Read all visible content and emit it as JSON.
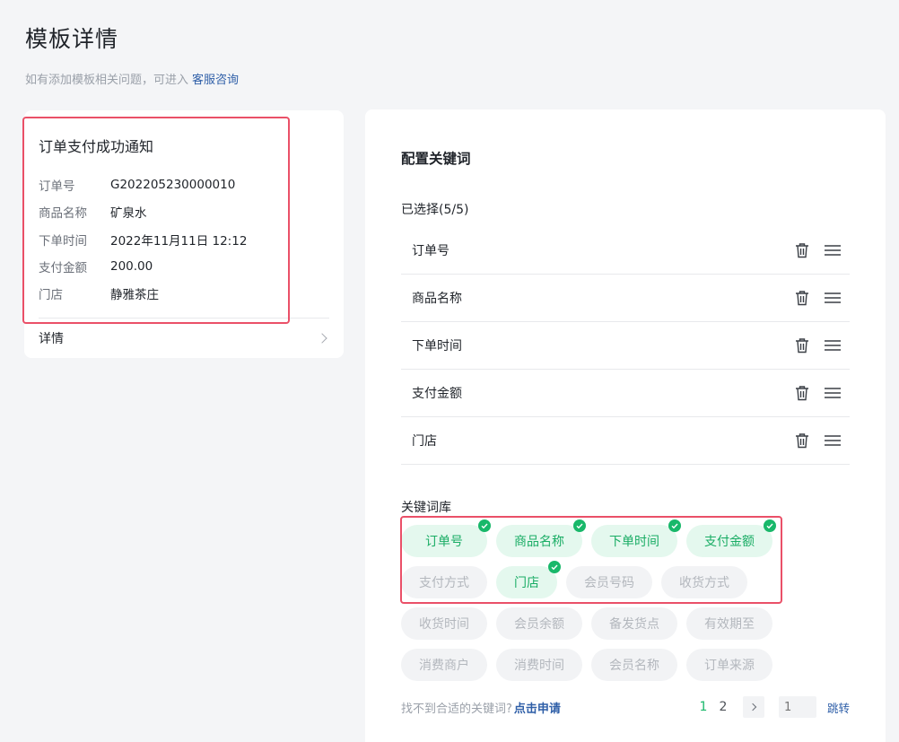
{
  "page": {
    "title": "模板详情",
    "hint": "如有添加模板相关问题，可进入",
    "support_link": "客服咨询"
  },
  "preview": {
    "title": "订单支付成功通知",
    "rows": [
      {
        "key": "订单号",
        "value": "G202205230000010"
      },
      {
        "key": "商品名称",
        "value": "矿泉水"
      },
      {
        "key": "下单时间",
        "value": "2022年11月11日 12:12"
      },
      {
        "key": "支付金额",
        "value": "200.00"
      },
      {
        "key": "门店",
        "value": "静雅茶庄"
      }
    ],
    "detail_label": "详情"
  },
  "config": {
    "title": "配置关键词",
    "selected_label": "已选择(5/5)",
    "selected": [
      "订单号",
      "商品名称",
      "下单时间",
      "支付金额",
      "门店"
    ],
    "library_label": "关键词库",
    "library": [
      [
        {
          "label": "订单号",
          "selected": true
        },
        {
          "label": "商品名称",
          "selected": true
        },
        {
          "label": "下单时间",
          "selected": true
        },
        {
          "label": "支付金额",
          "selected": true
        }
      ],
      [
        {
          "label": "支付方式",
          "selected": false
        },
        {
          "label": "门店",
          "selected": true
        },
        {
          "label": "会员号码",
          "selected": false
        },
        {
          "label": "收货方式",
          "selected": false
        }
      ],
      [
        {
          "label": "收货时间",
          "selected": false
        },
        {
          "label": "会员余额",
          "selected": false
        },
        {
          "label": "备发货点",
          "selected": false
        },
        {
          "label": "有效期至",
          "selected": false
        }
      ],
      [
        {
          "label": "消费商户",
          "selected": false
        },
        {
          "label": "消费时间",
          "selected": false
        },
        {
          "label": "会员名称",
          "selected": false
        },
        {
          "label": "订单来源",
          "selected": false
        }
      ]
    ],
    "footer_hint": "找不到合适的关键词?",
    "apply_link": "点击申请",
    "pager": {
      "pages": [
        "1",
        "2"
      ],
      "current": "1",
      "input_placeholder": "1",
      "jump_label": "跳转"
    }
  },
  "colors": {
    "accent_green": "#19b86a",
    "highlight_red": "#ea5068",
    "link_blue": "#2f5fa8"
  }
}
